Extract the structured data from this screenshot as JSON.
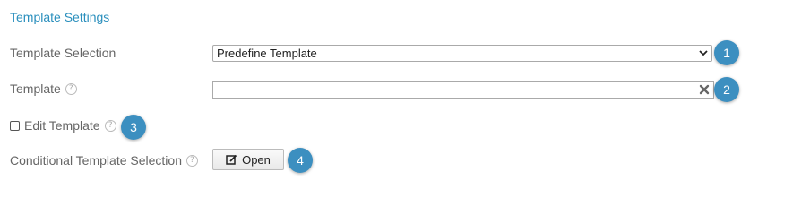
{
  "section": {
    "title": "Template Settings"
  },
  "rows": {
    "template_selection": {
      "label": "Template Selection",
      "value": "Predefine Template"
    },
    "template": {
      "label": "Template",
      "value": ""
    },
    "edit_template": {
      "label": "Edit Template",
      "checked": false
    },
    "conditional": {
      "label": "Conditional Template Selection",
      "button_label": "Open"
    }
  },
  "help_glyph": "?",
  "badges": [
    "1",
    "2",
    "3",
    "4"
  ],
  "colors": {
    "accent": "#2a8fbd",
    "badge": "#3c8fc0"
  },
  "icons": {
    "help": "help-icon",
    "dropdown": "chevron-down-icon",
    "clear": "close-icon",
    "edit": "edit-icon"
  }
}
